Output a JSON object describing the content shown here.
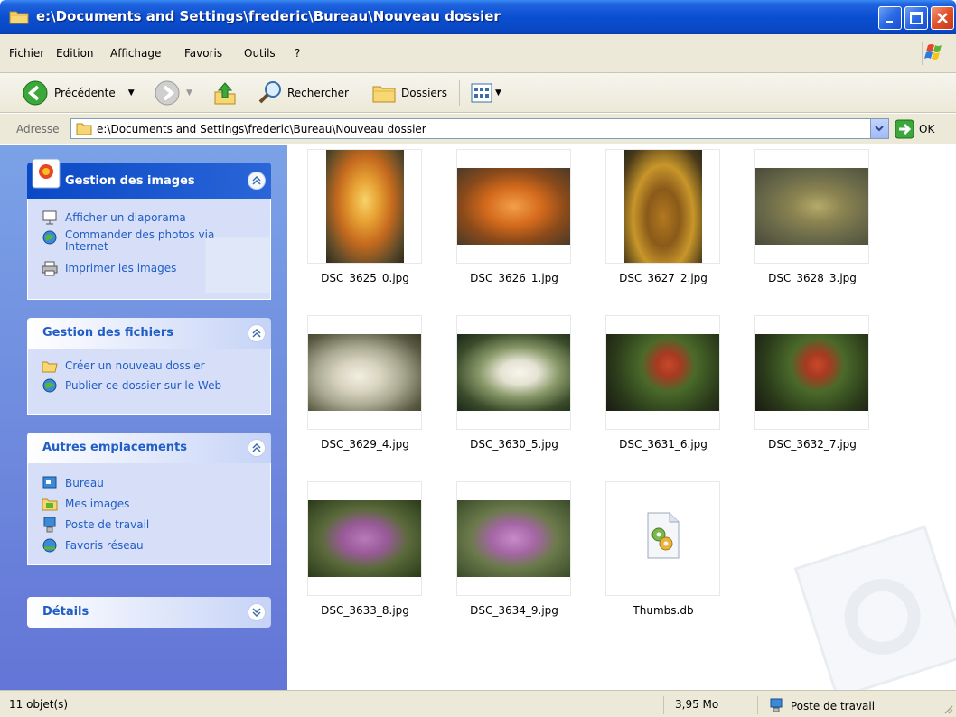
{
  "window": {
    "title": "e:\\Documents and Settings\\frederic\\Bureau\\Nouveau dossier"
  },
  "menu": {
    "items": [
      "Fichier",
      "Edition",
      "Affichage",
      "Favoris",
      "Outils",
      "?"
    ]
  },
  "toolbar": {
    "back_label": "Précédente",
    "search_label": "Rechercher",
    "folders_label": "Dossiers"
  },
  "address": {
    "label": "Adresse",
    "value": "e:\\Documents and Settings\\frederic\\Bureau\\Nouveau dossier",
    "go_label": "OK"
  },
  "panels": {
    "images": {
      "title": "Gestion des images",
      "items": [
        "Afficher un diaporama",
        "Commander des photos via Internet",
        "Imprimer les images"
      ]
    },
    "files": {
      "title": "Gestion des fichiers",
      "items": [
        "Créer un nouveau dossier",
        "Publier ce dossier sur le Web"
      ]
    },
    "places": {
      "title": "Autres emplacements",
      "items": [
        "Bureau",
        "Mes images",
        "Poste de travail",
        "Favoris réseau"
      ]
    },
    "details": {
      "title": "Détails"
    }
  },
  "files": [
    {
      "name": "DSC_3625_0.jpg"
    },
    {
      "name": "DSC_3626_1.jpg"
    },
    {
      "name": "DSC_3627_2.jpg"
    },
    {
      "name": "DSC_3628_3.jpg"
    },
    {
      "name": "DSC_3629_4.jpg"
    },
    {
      "name": "DSC_3630_5.jpg"
    },
    {
      "name": "DSC_3631_6.jpg"
    },
    {
      "name": "DSC_3632_7.jpg"
    },
    {
      "name": "DSC_3633_8.jpg"
    },
    {
      "name": "DSC_3634_9.jpg"
    },
    {
      "name": "Thumbs.db"
    }
  ],
  "status": {
    "count": "11 objet(s)",
    "size": "3,95 Mo",
    "zone": "Poste de travail"
  },
  "colors": {
    "titlebar": "#0a4fd1",
    "taskpane": "#6375d6",
    "link": "#215dc6"
  }
}
